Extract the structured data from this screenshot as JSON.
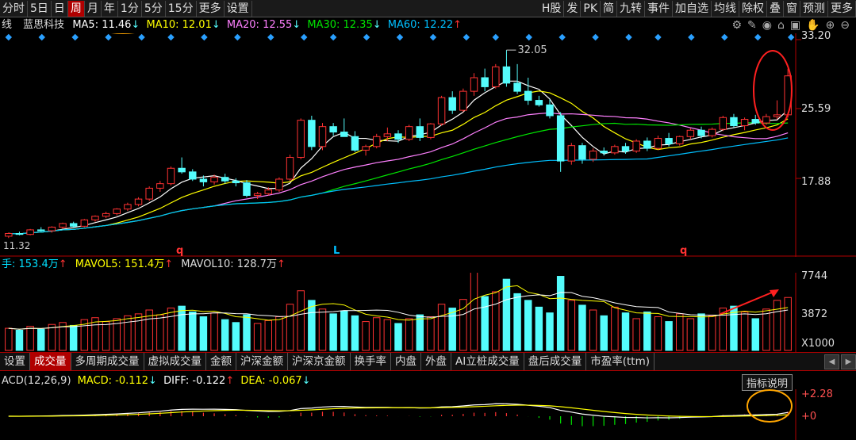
{
  "toolbar": {
    "items": [
      "分时",
      "5日",
      "日",
      "周",
      "月",
      "年",
      "1分",
      "5分",
      "15分",
      "更多",
      "设置"
    ],
    "active": "周",
    "right_items": [
      "H股",
      "发",
      "PK",
      "简",
      "九转",
      "事件",
      "加自选",
      "均线",
      "除权",
      "叠",
      "窗",
      "预测",
      "更多"
    ]
  },
  "title": {
    "chart_name": "线",
    "stock_name": "蓝思科技",
    "ma5": "MA5: 11.46",
    "ma10": "MA10: 12.01",
    "ma20": "MA20: 12.55",
    "ma30": "MA30: 12.35",
    "ma60": "MA60: 12.22"
  },
  "colors": {
    "up": "#ff3232",
    "down": "#54fcfc",
    "ma5": "#ffffff",
    "ma10": "#ffff00",
    "ma20": "#ff80ff",
    "ma30": "#00e600",
    "ma60": "#00c0ff",
    "accent": "#b00000",
    "circle": "#ffa500"
  },
  "price_axis": [
    "33.20",
    "25.59",
    "17.88"
  ],
  "annotations": {
    "high": "32.05",
    "low": "11.32",
    "marker_q1": "q",
    "marker_l": "L",
    "marker_q2": "q"
  },
  "volume": {
    "header_vol": "手: 153.4万",
    "mavol5": "MAVOL5: 151.4万",
    "mavol10": "MAVOL10: 128.7万",
    "axis": [
      "7744",
      "3872",
      "X1000"
    ]
  },
  "tabs": {
    "items": [
      "设置",
      "成交量",
      "多周期成交量",
      "虚拟成交量",
      "金额",
      "沪深金额",
      "沪深京金额",
      "换手率",
      "内盘",
      "外盘",
      "AI立桩成交量",
      "盘后成交量",
      "市盈率(ttm)"
    ],
    "active": "成交量"
  },
  "macd": {
    "label": "ACD(12,26,9)",
    "macd": "MACD: -0.112",
    "diff": "DIFF: -0.122",
    "dea": "DEA: -0.067",
    "axis": [
      "+2.28",
      "+0"
    ],
    "help": "指标说明"
  },
  "chart_data": {
    "type": "candlestick",
    "candles": [
      [
        11.5,
        11.9,
        11.3,
        11.8
      ],
      [
        11.8,
        12.0,
        11.6,
        11.7
      ],
      [
        11.7,
        12.3,
        11.6,
        12.2
      ],
      [
        12.2,
        12.5,
        12.0,
        12.1
      ],
      [
        12.1,
        12.6,
        11.9,
        12.5
      ],
      [
        12.5,
        13.0,
        12.3,
        12.9
      ],
      [
        12.9,
        13.1,
        12.4,
        12.6
      ],
      [
        12.6,
        13.4,
        12.5,
        13.3
      ],
      [
        13.3,
        13.8,
        13.1,
        13.7
      ],
      [
        13.7,
        14.2,
        13.5,
        14.0
      ],
      [
        14.0,
        14.6,
        13.8,
        14.5
      ],
      [
        14.5,
        15.2,
        14.3,
        15.0
      ],
      [
        15.0,
        15.8,
        14.8,
        15.6
      ],
      [
        15.6,
        17.0,
        15.4,
        16.8
      ],
      [
        16.8,
        17.6,
        16.4,
        17.3
      ],
      [
        17.3,
        19.2,
        17.1,
        19.0
      ],
      [
        19.0,
        20.2,
        18.4,
        18.6
      ],
      [
        18.6,
        18.9,
        17.6,
        17.8
      ],
      [
        17.8,
        18.2,
        17.0,
        17.5
      ],
      [
        17.5,
        18.3,
        17.2,
        18.0
      ],
      [
        18.0,
        18.4,
        17.3,
        17.6
      ],
      [
        17.6,
        17.9,
        17.0,
        17.4
      ],
      [
        17.4,
        17.7,
        15.8,
        16.0
      ],
      [
        16.0,
        16.4,
        15.6,
        16.2
      ],
      [
        16.2,
        16.9,
        16.0,
        16.6
      ],
      [
        16.6,
        18.0,
        16.4,
        17.8
      ],
      [
        17.8,
        20.5,
        17.6,
        20.2
      ],
      [
        20.2,
        24.5,
        20.0,
        24.3
      ],
      [
        24.3,
        24.8,
        21.0,
        21.4
      ],
      [
        21.4,
        24.0,
        21.0,
        23.6
      ],
      [
        23.6,
        24.0,
        22.6,
        23.0
      ],
      [
        23.0,
        24.5,
        22.8,
        22.5
      ],
      [
        22.5,
        23.1,
        20.8,
        21.0
      ],
      [
        21.0,
        21.6,
        20.4,
        21.4
      ],
      [
        21.4,
        22.8,
        21.2,
        22.5
      ],
      [
        22.5,
        23.5,
        22.0,
        22.8
      ],
      [
        22.8,
        23.2,
        21.8,
        22.2
      ],
      [
        22.2,
        23.8,
        22.0,
        23.6
      ],
      [
        23.6,
        24.5,
        22.0,
        22.4
      ],
      [
        22.4,
        24.0,
        22.2,
        23.9
      ],
      [
        23.9,
        27.0,
        23.7,
        26.8
      ],
      [
        26.8,
        27.5,
        25.0,
        25.4
      ],
      [
        25.4,
        27.8,
        25.2,
        27.5
      ],
      [
        27.5,
        29.5,
        27.0,
        29.0
      ],
      [
        29.0,
        30.0,
        27.5,
        28.0
      ],
      [
        28.0,
        30.5,
        27.8,
        30.2
      ],
      [
        30.2,
        32.05,
        28.0,
        28.4
      ],
      [
        28.4,
        30.5,
        27.2,
        27.5
      ],
      [
        27.5,
        29.0,
        26.0,
        26.5
      ],
      [
        26.5,
        27.0,
        25.8,
        26.0
      ],
      [
        26.0,
        26.6,
        24.5,
        24.8
      ],
      [
        24.8,
        25.2,
        18.6,
        19.8
      ],
      [
        19.8,
        21.8,
        19.4,
        21.5
      ],
      [
        21.5,
        21.8,
        19.5,
        20.0
      ],
      [
        20.0,
        21.2,
        19.7,
        20.9
      ],
      [
        20.9,
        21.3,
        20.4,
        20.7
      ],
      [
        20.7,
        21.6,
        20.5,
        21.4
      ],
      [
        21.4,
        21.8,
        20.6,
        20.9
      ],
      [
        20.9,
        22.2,
        20.7,
        22.0
      ],
      [
        22.0,
        22.4,
        20.9,
        21.2
      ],
      [
        21.2,
        22.6,
        21.0,
        22.3
      ],
      [
        22.3,
        22.9,
        21.4,
        21.7
      ],
      [
        21.7,
        22.6,
        21.5,
        22.5
      ],
      [
        22.5,
        23.4,
        22.2,
        23.2
      ],
      [
        23.2,
        23.6,
        22.3,
        22.6
      ],
      [
        22.6,
        23.5,
        22.4,
        23.3
      ],
      [
        23.3,
        24.8,
        23.1,
        24.6
      ],
      [
        24.6,
        25.0,
        23.5,
        23.7
      ],
      [
        23.7,
        24.6,
        23.2,
        24.4
      ],
      [
        24.4,
        24.9,
        23.8,
        24.0
      ],
      [
        24.0,
        25.0,
        23.8,
        24.7
      ],
      [
        24.7,
        26.5,
        24.4,
        24.9
      ],
      [
        24.9,
        30.0,
        24.6,
        29.2
      ]
    ],
    "volumes": [
      2300,
      2100,
      2500,
      2200,
      2700,
      2900,
      2600,
      3200,
      3400,
      3000,
      3300,
      3600,
      3800,
      4200,
      3700,
      4400,
      4600,
      4000,
      3500,
      3900,
      3200,
      2900,
      3700,
      2800,
      3100,
      3500,
      4800,
      6200,
      5200,
      4300,
      3800,
      4100,
      3600,
      3000,
      3400,
      3200,
      2800,
      3300,
      3700,
      3500,
      4800,
      4400,
      5300,
      8600,
      5600,
      6100,
      7400,
      5900,
      5200,
      4500,
      3900,
      7700,
      5200,
      4700,
      4200,
      3600,
      4500,
      3900,
      3300,
      4000,
      3500,
      3000,
      3800,
      3300,
      3800,
      3600,
      4400,
      4600,
      4000,
      3300,
      4300,
      5200,
      5500
    ],
    "volume_ylim": [
      0,
      7744
    ],
    "price_ylim": [
      11.32,
      33.2
    ]
  }
}
